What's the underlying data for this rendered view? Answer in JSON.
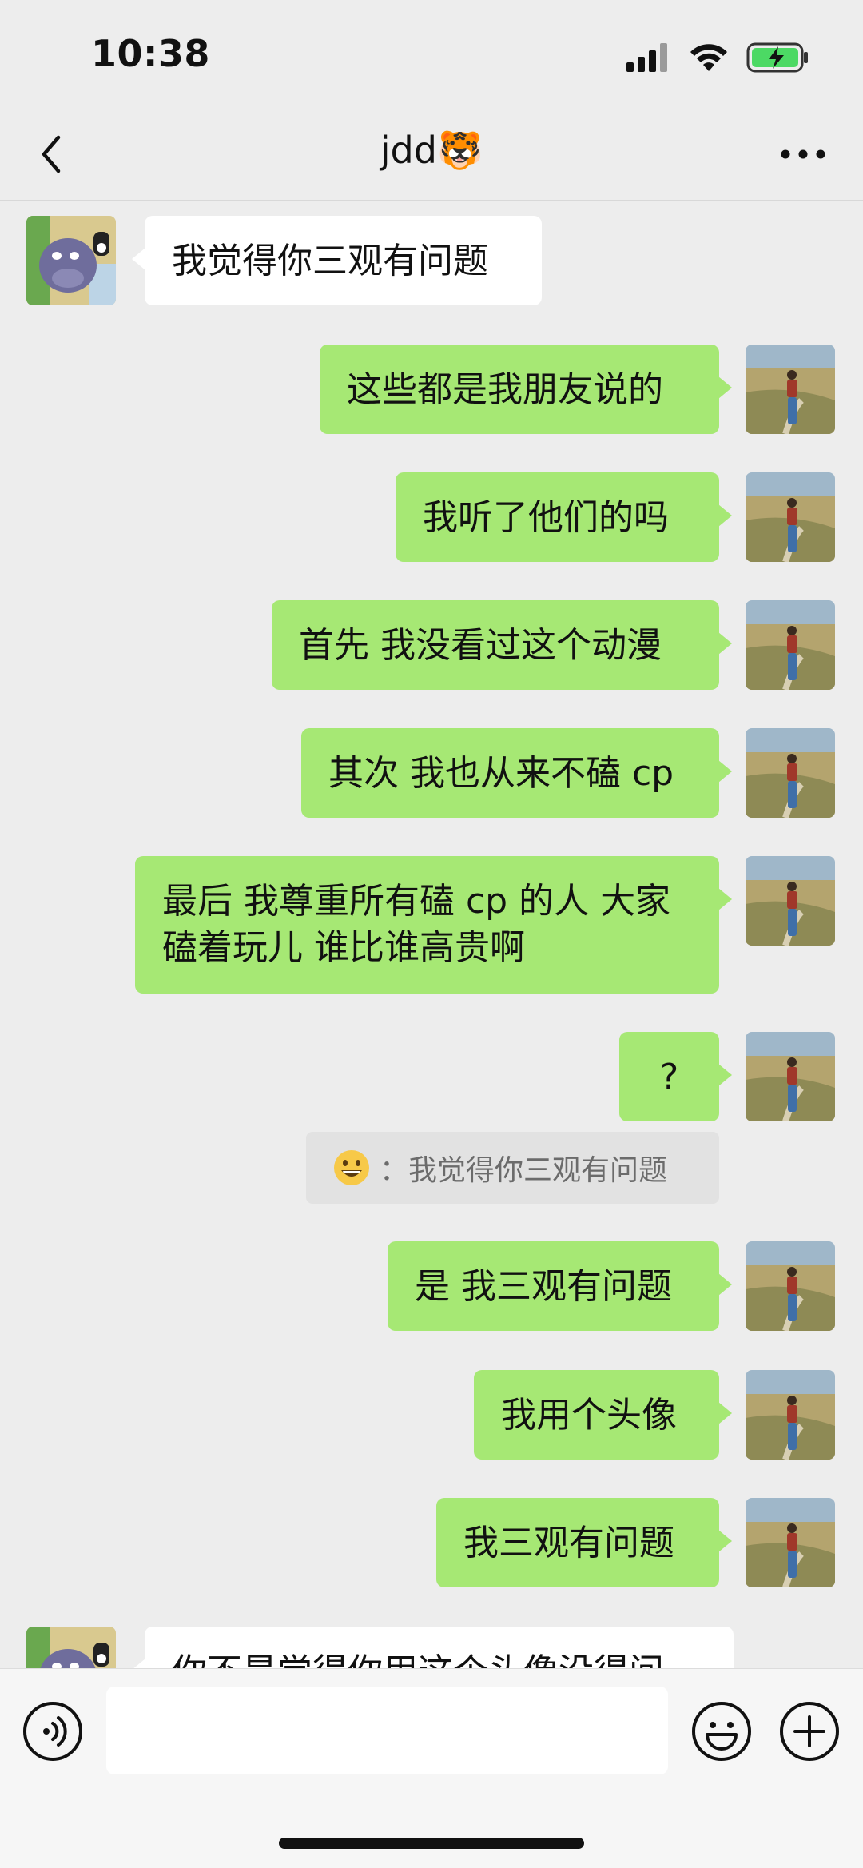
{
  "status_bar": {
    "time": "10:38",
    "battery": "charging"
  },
  "header": {
    "title": "jdd🐯",
    "back_icon": "chevron-left-icon",
    "more_icon": "more-horizontal-icon"
  },
  "messages": [
    {
      "side": "in",
      "text": "我觉得你三观有问题"
    },
    {
      "side": "out",
      "text": "这些都是我朋友说的"
    },
    {
      "side": "out",
      "text": "我听了他们的吗"
    },
    {
      "side": "out",
      "text": "首先 我没看过这个动漫"
    },
    {
      "side": "out",
      "text": "其次 我也从来不磕 cp"
    },
    {
      "side": "out",
      "text": "最后 我尊重所有磕 cp 的人 大家\n磕着玩儿 谁比谁高贵啊"
    },
    {
      "side": "out",
      "text": "?"
    },
    {
      "side": "out",
      "text": "是 我三观有问题"
    },
    {
      "side": "out",
      "text": "我用个头像"
    },
    {
      "side": "out",
      "text": "我三观有问题"
    },
    {
      "side": "in",
      "text": "你不是觉得你用这个头像没得问"
    }
  ],
  "quote": {
    "text": "：我觉得你三观有问题"
  },
  "input_bar": {
    "placeholder": ""
  },
  "colors": {
    "out_bubble": "#a6e874",
    "in_bubble": "#ffffff",
    "background": "#ededed"
  }
}
